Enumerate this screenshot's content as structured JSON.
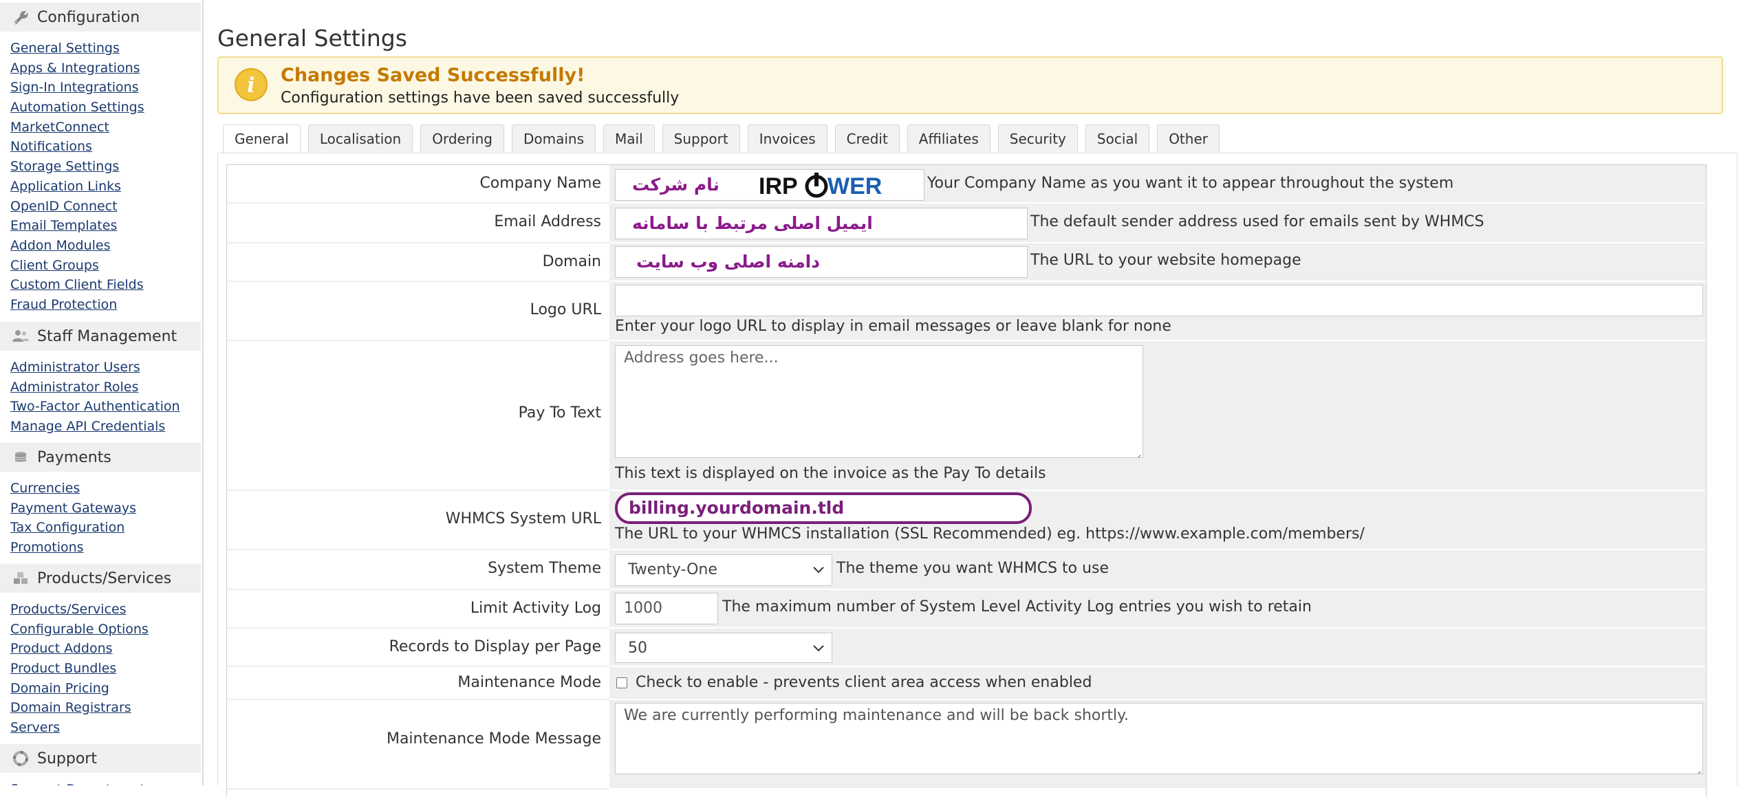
{
  "sidebar": {
    "sections": [
      {
        "title": "Configuration",
        "icon": "wrench-icon",
        "links": [
          "General Settings",
          "Apps & Integrations",
          "Sign-In Integrations",
          "Automation Settings",
          "MarketConnect",
          "Notifications",
          "Storage Settings",
          "Application Links",
          "OpenID Connect",
          "Email Templates",
          "Addon Modules",
          "Client Groups",
          "Custom Client Fields",
          "Fraud Protection"
        ]
      },
      {
        "title": "Staff Management",
        "icon": "users-icon",
        "links": [
          "Administrator Users",
          "Administrator Roles",
          "Two-Factor Authentication",
          "Manage API Credentials"
        ]
      },
      {
        "title": "Payments",
        "icon": "coins-icon",
        "links": [
          "Currencies",
          "Payment Gateways",
          "Tax Configuration",
          "Promotions"
        ]
      },
      {
        "title": "Products/Services",
        "icon": "cubes-icon",
        "links": [
          "Products/Services",
          "Configurable Options",
          "Product Addons",
          "Product Bundles",
          "Domain Pricing",
          "Domain Registrars",
          "Servers"
        ]
      },
      {
        "title": "Support",
        "icon": "lifebuoy-icon",
        "links": [
          "Support Departments"
        ]
      }
    ]
  },
  "page": {
    "title": "General Settings"
  },
  "alert": {
    "title": "Changes Saved Successfully!",
    "message": "Configuration settings have been saved successfully",
    "icon": "info-icon"
  },
  "tabs": [
    "General",
    "Localisation",
    "Ordering",
    "Domains",
    "Mail",
    "Support",
    "Invoices",
    "Credit",
    "Affiliates",
    "Security",
    "Social",
    "Other"
  ],
  "form": {
    "company_name": {
      "label": "Company Name",
      "value_rtl": "نام شرکت",
      "overlay_logo": "IRPOWER",
      "help": "Your Company Name as you want it to appear throughout the system"
    },
    "email_address": {
      "label": "Email Address",
      "value_rtl": "ایمیل اصلی مرتبط با سامانه",
      "help": "The default sender address used for emails sent by WHMCS"
    },
    "domain": {
      "label": "Domain",
      "value_rtl": "دامنه اصلی وب سایت",
      "help": "The URL to your website homepage"
    },
    "logo_url": {
      "label": "Logo URL",
      "value": "",
      "help": "Enter your logo URL to display in email messages or leave blank for none"
    },
    "pay_to_text": {
      "label": "Pay To Text",
      "placeholder": "Address goes here...",
      "help": "This text is displayed on the invoice as the Pay To details"
    },
    "system_url": {
      "label": "WHMCS System URL",
      "value": "billing.yourdomain.tld",
      "help": "The URL to your WHMCS installation (SSL Recommended) eg. https://www.example.com/members/",
      "highlight_color": "#7a1f7a"
    },
    "system_theme": {
      "label": "System Theme",
      "value": "Twenty-One",
      "help": "The theme you want WHMCS to use"
    },
    "limit_activity_log": {
      "label": "Limit Activity Log",
      "value": "1000",
      "help": "The maximum number of System Level Activity Log entries you wish to retain"
    },
    "records_per_page": {
      "label": "Records to Display per Page",
      "value": "50"
    },
    "maintenance_mode": {
      "label": "Maintenance Mode",
      "checked": false,
      "help": "Check to enable - prevents client area access when enabled"
    },
    "maintenance_message": {
      "label": "Maintenance Mode Message",
      "value": "We are currently performing maintenance and will be back shortly."
    }
  },
  "colors": {
    "alert_bg": "#fcf8e3",
    "alert_title": "#c47a00",
    "link": "#1a3a6e",
    "rtl_text": "#8b1a8b"
  }
}
